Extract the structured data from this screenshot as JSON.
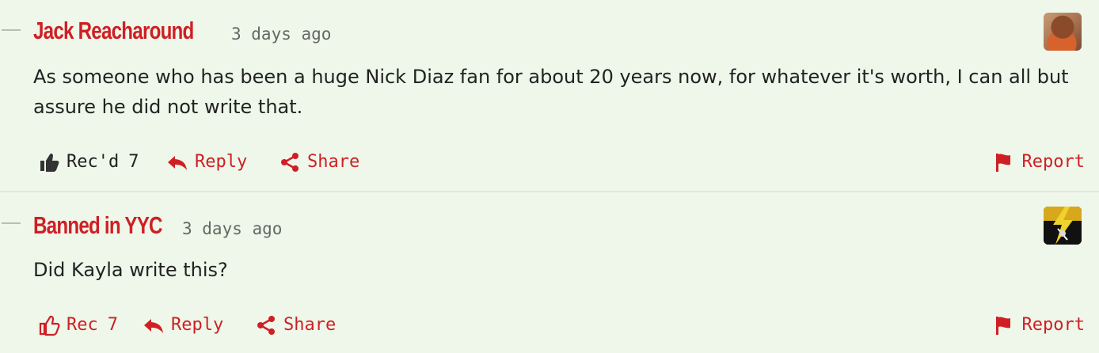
{
  "colors": {
    "accent": "#cf1f25",
    "background": "#eef7e9",
    "text": "#222222",
    "muted": "#666666"
  },
  "comments": [
    {
      "author": "Jack Reacharound",
      "timestamp": "3 days ago",
      "avatar_icon": "user-avatar-portrait",
      "body": "As someone who has been a huge Nick Diaz fan for about 20 years now, for whatever it's worth, I can all but assure he did not write that.",
      "actions": {
        "rec_label": "Rec'd",
        "rec_count": "7",
        "rec_state": "recommended",
        "reply_label": "Reply",
        "share_label": "Share",
        "report_label": "Report"
      }
    },
    {
      "author": "Banned in YYC",
      "timestamp": "3 days ago",
      "avatar_icon": "lightning-bolt-avatar",
      "body": "Did Kayla write this?",
      "actions": {
        "rec_label": "Rec",
        "rec_count": "7",
        "rec_state": "not-recommended",
        "reply_label": "Reply",
        "share_label": "Share",
        "report_label": "Report"
      }
    }
  ]
}
